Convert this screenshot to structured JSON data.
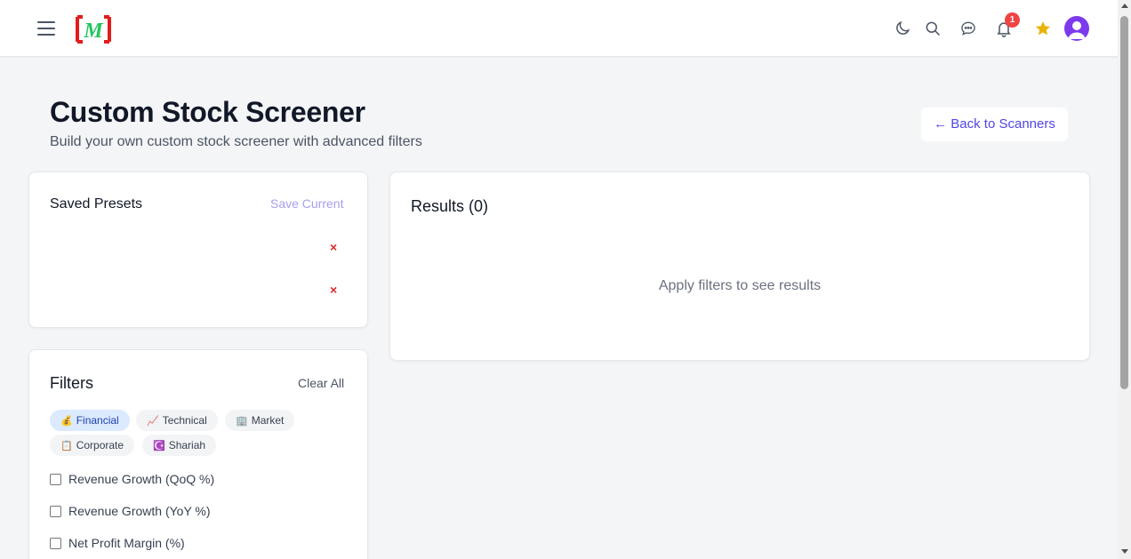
{
  "header": {
    "logo_text": "M",
    "notification_count": "1",
    "icons": [
      "menu-icon",
      "moon-icon",
      "search-icon",
      "chat-icon",
      "bell-icon",
      "star-icon",
      "user-icon"
    ],
    "colors": {
      "logo_red": "#e11d1d",
      "logo_green": "#22c55e",
      "star": "#eab308",
      "avatar": "#7c3aed",
      "badge": "#ef4444"
    }
  },
  "page": {
    "title": "Custom Stock Screener",
    "subtitle": "Build your own custom stock screener with advanced filters",
    "back_label": "← Back to Scanners"
  },
  "presets": {
    "title": "Saved Presets",
    "save_label": "Save Current",
    "delete_glyph": "×"
  },
  "results": {
    "title": "Results (0)",
    "empty_message": "Apply filters to see results"
  },
  "filters": {
    "title": "Filters",
    "clear_label": "Clear All",
    "categories": [
      {
        "icon": "💰",
        "label": "Financial",
        "active": true
      },
      {
        "icon": "📈",
        "label": "Technical",
        "active": false
      },
      {
        "icon": "🏢",
        "label": "Market",
        "active": false
      },
      {
        "icon": "📋",
        "label": "Corporate",
        "active": false
      },
      {
        "icon": "☪️",
        "label": "Shariah",
        "active": false
      }
    ],
    "items": [
      {
        "label": "Revenue Growth (QoQ %)",
        "checked": false
      },
      {
        "label": "Revenue Growth (YoY %)",
        "checked": false
      },
      {
        "label": "Net Profit Margin (%)",
        "checked": false
      }
    ]
  }
}
